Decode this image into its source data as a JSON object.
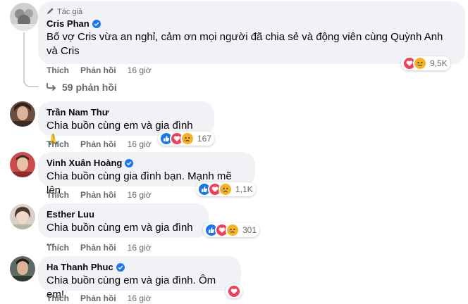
{
  "comments": [
    {
      "author_tag": "Tác giả",
      "name": "Cris Phan",
      "verified": true,
      "text": "Bố vợ Cris vừa an nghỉ, cảm ơn mọi người đã chia sẻ và động viên cùng Quỳnh Anh và Cris",
      "like_label": "Thích",
      "reply_label": "Phản hồi",
      "time": "16 giờ",
      "reactions": [
        "love",
        "sad"
      ],
      "reaction_count": "9,5K"
    },
    {
      "name": "Trần Nam Thư",
      "verified": false,
      "text": "Chia buồn cùng em và gia đình 🙏",
      "like_label": "Thích",
      "reply_label": "Phản hồi",
      "time": "16 giờ",
      "reactions": [
        "like",
        "love",
        "sad"
      ],
      "reaction_count": "167"
    },
    {
      "name": "Vinh Xuân Hoàng",
      "verified": true,
      "text": "Chia buồn cùng gia đình bạn. Mạnh mẽ lên",
      "like_label": "Thích",
      "reply_label": "Phản hồi",
      "time": "16 giờ",
      "reactions": [
        "like",
        "love",
        "sad"
      ],
      "reaction_count": "1,1K"
    },
    {
      "name": "Esther Luu",
      "verified": false,
      "text": "Chia buồn cùng em và gia đình ...",
      "like_label": "Thích",
      "reply_label": "Phản hồi",
      "time": "16 giờ",
      "reactions": [
        "like",
        "love",
        "sad"
      ],
      "reaction_count": "301"
    },
    {
      "name": "Ha Thanh Phuc",
      "verified": true,
      "text": "Chia buồn cùng em và gia đình. Ôm em!",
      "like_label": "Thích",
      "reply_label": "Phản hồi",
      "time": "16 giờ",
      "reactions": [
        "love"
      ],
      "reaction_count": ""
    }
  ],
  "replies_link": "59 phản hồi",
  "icons": {
    "author_badge": "pencil-icon",
    "verified": "verified-badge-icon",
    "replies": "reply-arrow-icon"
  },
  "colors": {
    "bubble": "#f0f2f5",
    "verified": "#1877f2",
    "secondary_text": "#65676b",
    "like": "#1877f2",
    "love": "#f33e58",
    "sad": "#f7b125"
  }
}
